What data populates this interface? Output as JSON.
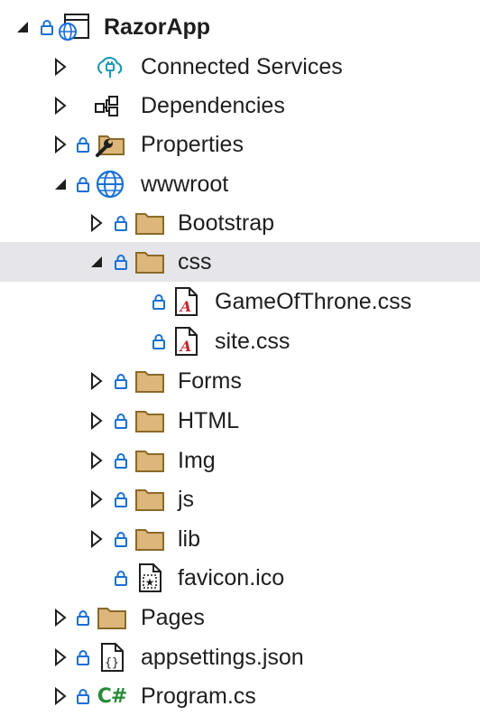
{
  "solution_explorer": {
    "items": [
      {
        "label": "RazorApp",
        "icon": "web-project-icon",
        "expanded": true,
        "locked": true
      },
      {
        "label": "Connected Services",
        "icon": "connected-services-icon",
        "expanded": false,
        "locked": false
      },
      {
        "label": "Dependencies",
        "icon": "dependencies-icon",
        "expanded": false,
        "locked": false
      },
      {
        "label": "Properties",
        "icon": "properties-folder-icon",
        "expanded": false,
        "locked": true
      },
      {
        "label": "wwwroot",
        "icon": "globe-icon",
        "expanded": true,
        "locked": true
      },
      {
        "label": "Bootstrap",
        "icon": "folder-icon",
        "expanded": false,
        "locked": true
      },
      {
        "label": "css",
        "icon": "folder-icon",
        "expanded": true,
        "locked": true,
        "selected": true
      },
      {
        "label": "GameOfThrone.css",
        "icon": "css-file-icon",
        "locked": true
      },
      {
        "label": "site.css",
        "icon": "css-file-icon",
        "locked": true
      },
      {
        "label": "Forms",
        "icon": "folder-icon",
        "expanded": false,
        "locked": true
      },
      {
        "label": "HTML",
        "icon": "folder-icon",
        "expanded": false,
        "locked": true
      },
      {
        "label": "Img",
        "icon": "folder-icon",
        "expanded": false,
        "locked": true
      },
      {
        "label": "js",
        "icon": "folder-icon",
        "expanded": false,
        "locked": true
      },
      {
        "label": "lib",
        "icon": "folder-icon",
        "expanded": false,
        "locked": true
      },
      {
        "label": "favicon.ico",
        "icon": "image-file-icon",
        "locked": true
      },
      {
        "label": "Pages",
        "icon": "folder-icon",
        "expanded": false,
        "locked": true
      },
      {
        "label": "appsettings.json",
        "icon": "json-file-icon",
        "expanded": false,
        "locked": true
      },
      {
        "label": "Program.cs",
        "icon": "csharp-file-icon",
        "expanded": false,
        "locked": true,
        "icon_text": "C#"
      }
    ]
  },
  "colors": {
    "lock": "#1a6fd6",
    "folder_fill": "#dcb67a",
    "folder_stroke": "#8a6a2a",
    "css_red": "#c4262e",
    "selection": "#e6e6ea",
    "csharp_green": "#2a8b3a"
  }
}
